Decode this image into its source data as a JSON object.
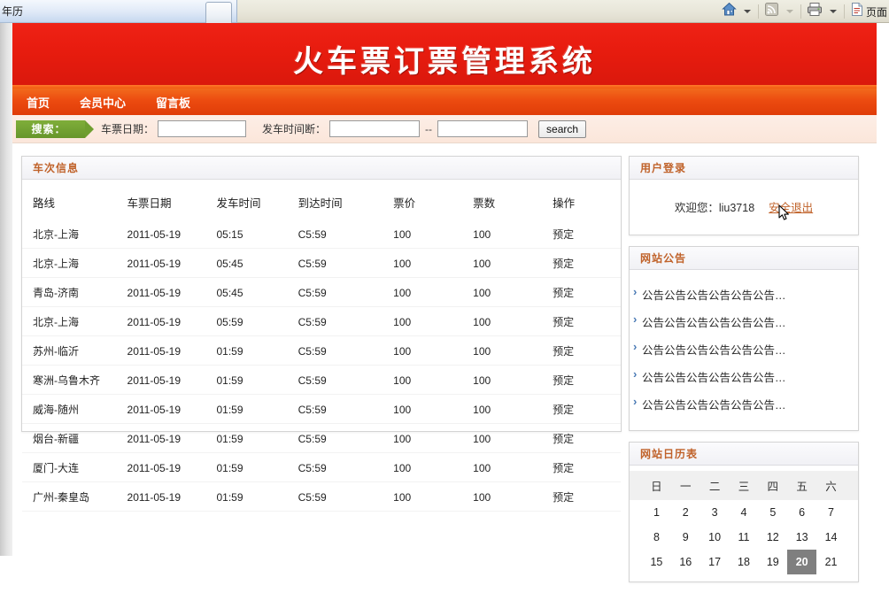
{
  "browser": {
    "tab_label": "年历",
    "new_tab_name": "new-tab",
    "toolbar": {
      "home_icon": "home-icon",
      "feeds_icon": "rss-feed-icon",
      "print_icon": "printer-icon",
      "page_icon": "page-icon",
      "page_menu_label": "页面"
    }
  },
  "banner": {
    "title": "火车票订票管理系统"
  },
  "nav": {
    "items": [
      {
        "label": "首页"
      },
      {
        "label": "会员中心"
      },
      {
        "label": "留言板"
      }
    ]
  },
  "search": {
    "tag_label": "搜索：",
    "date_label": "车票日期：",
    "date_value": "",
    "time_label": "发车时间断：",
    "time_from_value": "",
    "time_to_value": "",
    "range_separator": "--",
    "button_label": "search"
  },
  "trains_panel": {
    "title": "车次信息",
    "columns": [
      "路线",
      "车票日期",
      "发车时间",
      "到达时间",
      "票价",
      "票数",
      "操作"
    ],
    "rows": [
      {
        "route": "北京-上海",
        "date": "2011-05-19",
        "depart": "05:15",
        "arrive": "C5:59",
        "price": "100",
        "count": "100",
        "action": "预定"
      },
      {
        "route": "北京-上海",
        "date": "2011-05-19",
        "depart": "05:45",
        "arrive": "C5:59",
        "price": "100",
        "count": "100",
        "action": "预定"
      },
      {
        "route": "青岛-济南",
        "date": "2011-05-19",
        "depart": "05:45",
        "arrive": "C5:59",
        "price": "100",
        "count": "100",
        "action": "预定"
      },
      {
        "route": "北京-上海",
        "date": "2011-05-19",
        "depart": "05:59",
        "arrive": "C5:59",
        "price": "100",
        "count": "100",
        "action": "预定"
      },
      {
        "route": "苏州-临沂",
        "date": "2011-05-19",
        "depart": "01:59",
        "arrive": "C5:59",
        "price": "100",
        "count": "100",
        "action": "预定"
      },
      {
        "route": "寒洲-乌鲁木齐",
        "date": "2011-05-19",
        "depart": "01:59",
        "arrive": "C5:59",
        "price": "100",
        "count": "100",
        "action": "预定"
      },
      {
        "route": "威海-随州",
        "date": "2011-05-19",
        "depart": "01:59",
        "arrive": "C5:59",
        "price": "100",
        "count": "100",
        "action": "预定"
      },
      {
        "route": "烟台-新疆",
        "date": "2011-05-19",
        "depart": "01:59",
        "arrive": "C5:59",
        "price": "100",
        "count": "100",
        "action": "预定"
      },
      {
        "route": "厦门-大连",
        "date": "2011-05-19",
        "depart": "01:59",
        "arrive": "C5:59",
        "price": "100",
        "count": "100",
        "action": "预定"
      },
      {
        "route": "广州-秦皇岛",
        "date": "2011-05-19",
        "depart": "01:59",
        "arrive": "C5:59",
        "price": "100",
        "count": "100",
        "action": "预定"
      }
    ]
  },
  "login_panel": {
    "title": "用户登录",
    "welcome_text": "欢迎您：liu3718",
    "logout_label": "安全退出"
  },
  "notices_panel": {
    "title": "网站公告",
    "items": [
      {
        "text": "公告公告公告公告公告公告…"
      },
      {
        "text": "公告公告公告公告公告公告…"
      },
      {
        "text": "公告公告公告公告公告公告…"
      },
      {
        "text": "公告公告公告公告公告公告…"
      },
      {
        "text": "公告公告公告公告公告公告…"
      }
    ]
  },
  "calendar_panel": {
    "title": "网站日历表",
    "weekdays": [
      "日",
      "一",
      "二",
      "三",
      "四",
      "五",
      "六"
    ],
    "weeks": [
      [
        "1",
        "2",
        "3",
        "4",
        "5",
        "6",
        "7"
      ],
      [
        "8",
        "9",
        "10",
        "11",
        "12",
        "13",
        "14"
      ],
      [
        "15",
        "16",
        "17",
        "18",
        "19",
        "20",
        "21"
      ]
    ],
    "today": "20"
  },
  "colors": {
    "banner_red": "#e81c0f",
    "nav_orange": "#ec4b10",
    "search_green": "#7fae3a",
    "panel_title": "#c0622a",
    "today_highlight": "#7f7f7f"
  }
}
